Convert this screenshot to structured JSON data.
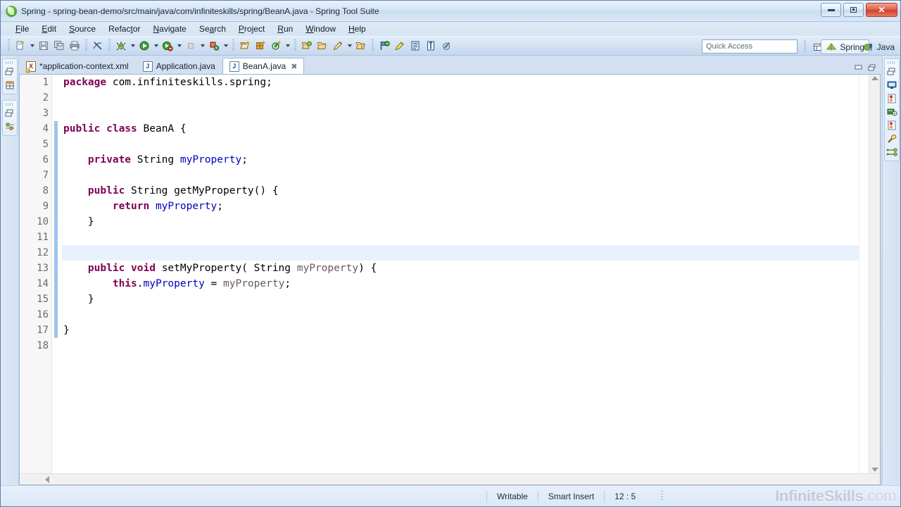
{
  "window": {
    "title": "Spring - spring-bean-demo/src/main/java/com/infiniteskills/spring/BeanA.java - Spring Tool Suite",
    "app_icon": "spring-leaf-icon",
    "controls": [
      {
        "name": "minimize-button",
        "glyph": "minimize-icon"
      },
      {
        "name": "maximize-button",
        "glyph": "maximize-icon"
      },
      {
        "name": "close-button",
        "glyph": "close-icon",
        "color": "#cf3f27"
      }
    ]
  },
  "menubar": {
    "items": [
      {
        "label": "File",
        "mnemonic": "F"
      },
      {
        "label": "Edit",
        "mnemonic": "E"
      },
      {
        "label": "Source",
        "mnemonic": "S"
      },
      {
        "label": "Refactor",
        "mnemonic": "t"
      },
      {
        "label": "Navigate",
        "mnemonic": "N"
      },
      {
        "label": "Search",
        "mnemonic": "a"
      },
      {
        "label": "Project",
        "mnemonic": "P"
      },
      {
        "label": "Run",
        "mnemonic": "R"
      },
      {
        "label": "Window",
        "mnemonic": "W"
      },
      {
        "label": "Help",
        "mnemonic": "H"
      }
    ]
  },
  "toolbar": {
    "buttons": [
      {
        "name": "new-wizard-button",
        "icon": "new-file-icon",
        "dropdown": true
      },
      {
        "name": "save-button",
        "icon": "save-icon",
        "dropdown": false
      },
      {
        "name": "save-all-button",
        "icon": "save-all-icon",
        "dropdown": false
      },
      {
        "name": "print-button",
        "icon": "print-icon",
        "dropdown": false
      },
      {
        "name": "toggle-mark-occurrences-button",
        "icon": "mark-occurrences-icon",
        "dropdown": false
      },
      {
        "name": "debug-button",
        "icon": "debug-bug-icon",
        "dropdown": true
      },
      {
        "name": "run-button",
        "icon": "run-play-icon",
        "dropdown": true
      },
      {
        "name": "run-as-server-button",
        "icon": "run-server-icon",
        "dropdown": true
      },
      {
        "name": "stop-button",
        "icon": "stop-icon",
        "dropdown": true
      },
      {
        "name": "run-on-server-button",
        "icon": "run-on-server-icon",
        "dropdown": true
      },
      {
        "name": "new-java-package-button",
        "icon": "new-package-icon",
        "dropdown": false
      },
      {
        "name": "new-java-class-button",
        "icon": "new-class-icon",
        "dropdown": false
      },
      {
        "name": "new-annotation-button",
        "icon": "new-annotation-icon",
        "dropdown": true
      },
      {
        "name": "open-type-button",
        "icon": "open-type-icon",
        "dropdown": false
      },
      {
        "name": "open-task-button",
        "icon": "open-folder-icon",
        "dropdown": false
      },
      {
        "name": "new-bean-config-button",
        "icon": "pencil-icon",
        "dropdown": true
      },
      {
        "name": "open-resource-button",
        "icon": "open-resource-icon",
        "dropdown": false
      },
      {
        "name": "search-button",
        "icon": "search-flag-icon",
        "dropdown": false
      },
      {
        "name": "annotate-button",
        "icon": "highlighter-icon",
        "dropdown": false
      },
      {
        "name": "toggle-block-selection-button",
        "icon": "block-selection-icon",
        "dropdown": false
      },
      {
        "name": "show-whitespace-button",
        "icon": "whitespace-icon",
        "dropdown": false
      },
      {
        "name": "previous-edit-button",
        "icon": "previous-edit-icon",
        "dropdown": false
      }
    ],
    "quick_access_placeholder": "Quick Access",
    "open-perspective-icon": "open-perspective-icon",
    "perspectives": [
      {
        "label": "Spring",
        "icon": "spring-perspective-icon",
        "active": true
      },
      {
        "label": "Java",
        "icon": "java-perspective-icon",
        "active": false
      }
    ]
  },
  "left_sidebar": {
    "stacks": [
      {
        "name": "view-stack-project",
        "icons": [
          "restore-view-icon",
          "spring-explorer-icon"
        ]
      },
      {
        "name": "view-stack-outline",
        "icons": [
          "restore-view-icon",
          "properties-icon"
        ]
      }
    ]
  },
  "right_sidebar": {
    "stack": {
      "name": "view-stack-console",
      "icons": [
        "restore-view-icon",
        "console-icon",
        "problems-icon",
        "servers-icon",
        "markers-icon",
        "search-view-icon",
        "bean-relations-icon"
      ]
    }
  },
  "editor": {
    "tabs": [
      {
        "label": "*application-context.xml",
        "icon_letter": "X",
        "icon_kind": "xml",
        "active": false,
        "dirty": true,
        "closable": false
      },
      {
        "label": "Application.java",
        "icon_letter": "J",
        "icon_kind": "java",
        "active": false,
        "dirty": false,
        "closable": false
      },
      {
        "label": "BeanA.java",
        "icon_letter": "J",
        "icon_kind": "java",
        "active": true,
        "dirty": false,
        "closable": true
      }
    ],
    "close_glyph": "✖",
    "stack_controls": [
      {
        "name": "minimize-editor-button",
        "icon": "minimize-icon"
      },
      {
        "name": "maximize-editor-button",
        "icon": "maximize-icon"
      }
    ],
    "current_line": 12,
    "fold_range": {
      "from": 4,
      "to": 17
    },
    "fold_markers": [
      8,
      13
    ],
    "lines": [
      {
        "n": 1,
        "tokens": [
          {
            "t": "package ",
            "c": "kw"
          },
          {
            "t": "com.infiniteskills.spring;",
            "c": "pln"
          }
        ]
      },
      {
        "n": 2,
        "tokens": []
      },
      {
        "n": 3,
        "tokens": []
      },
      {
        "n": 4,
        "tokens": [
          {
            "t": "public class ",
            "c": "kw"
          },
          {
            "t": "BeanA {",
            "c": "pln"
          }
        ]
      },
      {
        "n": 5,
        "tokens": []
      },
      {
        "n": 6,
        "tokens": [
          {
            "t": "    ",
            "c": "pln"
          },
          {
            "t": "private ",
            "c": "kw"
          },
          {
            "t": "String ",
            "c": "pln"
          },
          {
            "t": "myProperty",
            "c": "fld"
          },
          {
            "t": ";",
            "c": "pln"
          }
        ]
      },
      {
        "n": 7,
        "tokens": []
      },
      {
        "n": 8,
        "tokens": [
          {
            "t": "    ",
            "c": "pln"
          },
          {
            "t": "public ",
            "c": "kw"
          },
          {
            "t": "String getMyProperty() {",
            "c": "pln"
          }
        ]
      },
      {
        "n": 9,
        "tokens": [
          {
            "t": "        ",
            "c": "pln"
          },
          {
            "t": "return ",
            "c": "kw"
          },
          {
            "t": "myProperty",
            "c": "fld"
          },
          {
            "t": ";",
            "c": "pln"
          }
        ]
      },
      {
        "n": 10,
        "tokens": [
          {
            "t": "    }",
            "c": "pln"
          }
        ]
      },
      {
        "n": 11,
        "tokens": []
      },
      {
        "n": 12,
        "tokens": []
      },
      {
        "n": 13,
        "tokens": [
          {
            "t": "    ",
            "c": "pln"
          },
          {
            "t": "public void ",
            "c": "kw"
          },
          {
            "t": "setMyProperty( String ",
            "c": "pln"
          },
          {
            "t": "myProperty",
            "c": "par"
          },
          {
            "t": ") {",
            "c": "pln"
          }
        ]
      },
      {
        "n": 14,
        "tokens": [
          {
            "t": "        ",
            "c": "pln"
          },
          {
            "t": "this",
            "c": "kw"
          },
          {
            "t": ".",
            "c": "pln"
          },
          {
            "t": "myProperty",
            "c": "fld"
          },
          {
            "t": " = ",
            "c": "pln"
          },
          {
            "t": "myProperty",
            "c": "par"
          },
          {
            "t": ";",
            "c": "pln"
          }
        ]
      },
      {
        "n": 15,
        "tokens": [
          {
            "t": "    }",
            "c": "pln"
          }
        ]
      },
      {
        "n": 16,
        "tokens": []
      },
      {
        "n": 17,
        "tokens": [
          {
            "t": "}",
            "c": "pln"
          }
        ]
      },
      {
        "n": 18,
        "tokens": []
      }
    ]
  },
  "statusbar": {
    "writable": "Writable",
    "insert_mode": "Smart Insert",
    "cursor_position": "12 : 5",
    "watermark_bold": "InfiniteSkills",
    "watermark_dim": ".com"
  },
  "colors": {
    "keyword": "#7f0055",
    "field": "#0000c0",
    "parameter": "#6a5a5a",
    "current_line": "#e8f2fd",
    "fold_bar": "#7fb2e0",
    "close_button": "#cf3f27"
  }
}
